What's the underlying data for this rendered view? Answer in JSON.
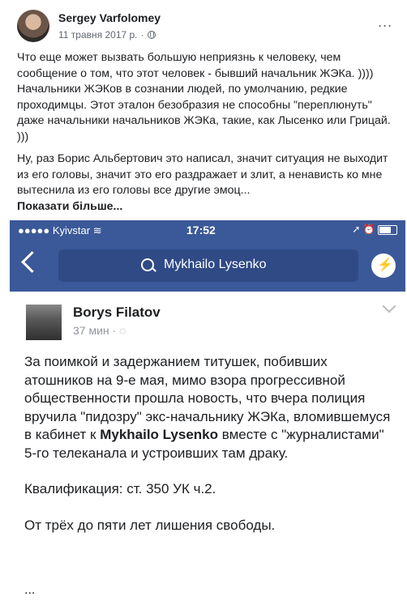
{
  "post": {
    "author": "Sergey Varfolomey",
    "date": "11 травня 2017 р.",
    "separator": "·",
    "more_icon": "...",
    "paragraph1": "Что еще может вызвать большую неприязнь к человеку, чем сообщение о том, что этот человек - бывший начальник ЖЭКа. )))) Начальники ЖЭКов в сознании людей, по умолчанию, редкие проходимцы. Этот эталон безобразия не способны \"переплюнуть\" даже начальники начальников ЖЭКа, такие, как Лысенко или Грицай. )))",
    "paragraph2": "Ну, раз Борис Альбертович это написал, значит ситуация не выходит из его головы, значит это его раздражает и злит, а ненависть ко мне вытеснила из его головы все другие эмоц...",
    "see_more": "Показати більше..."
  },
  "screenshot": {
    "status_bar": {
      "carrier": "●●●●● Kyivstar",
      "wifi": "≋",
      "time": "17:52",
      "right_icons": "➚ ⏰"
    },
    "search_query": "Mykhailo Lysenko",
    "inner_post": {
      "author": "Borys Filatov",
      "time": "37 мин",
      "separator": "·",
      "text_before_link": "За поимкой и задержанием титушек, побивших атошников на 9-е мая, мимо взора прогрессивной общественности прошла новость, что вчера полиция вручила \"пидозру\" экс-начальнику ЖЭКа, вломившемуся в кабинет к ",
      "link_name": "Mykhailo Lysenko",
      "text_after_link": " вместе с \"журналистами\" 5-го телеканала и устроивших там драку.",
      "paragraph2": "Квалификация: ст. 350 УК ч.2.",
      "paragraph3": "От трёх до пяти лет лишения свободы.",
      "ellipsis": "..."
    }
  },
  "colors": {
    "facebook_blue": "#3b5998",
    "text": "#1c1e21",
    "meta": "#606770"
  }
}
